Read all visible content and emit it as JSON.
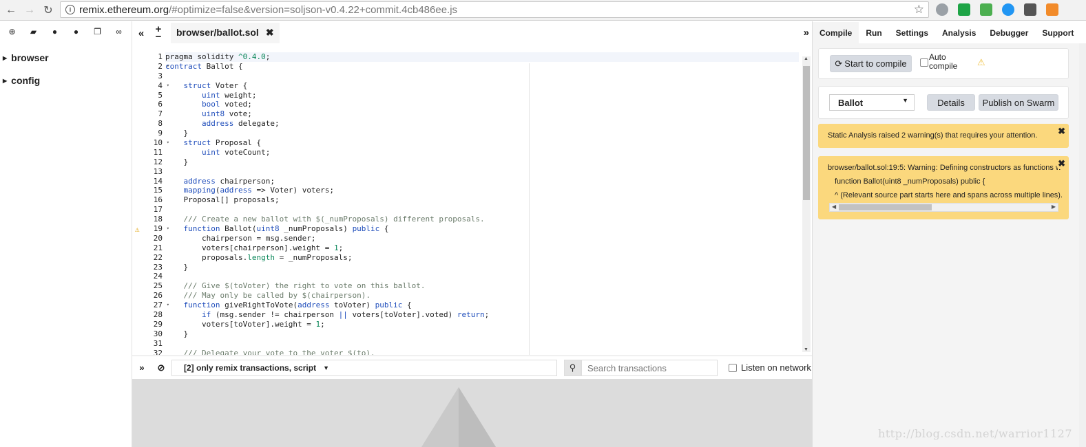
{
  "browser": {
    "url_host": "remix.ethereum.org",
    "url_path": "/#optimize=false&version=soljson-v0.4.22+commit.4cb486ee.js"
  },
  "file_explorer": {
    "items": [
      {
        "label": "browser"
      },
      {
        "label": "config"
      }
    ]
  },
  "editor": {
    "tab_label": "browser/ballot.sol",
    "gutter": [
      {
        "n": "1",
        "fold": "",
        "warn": ""
      },
      {
        "n": "2",
        "fold": "▾",
        "warn": ""
      },
      {
        "n": "3",
        "fold": "",
        "warn": ""
      },
      {
        "n": "4",
        "fold": "▾",
        "warn": ""
      },
      {
        "n": "5",
        "fold": "",
        "warn": ""
      },
      {
        "n": "6",
        "fold": "",
        "warn": ""
      },
      {
        "n": "7",
        "fold": "",
        "warn": ""
      },
      {
        "n": "8",
        "fold": "",
        "warn": ""
      },
      {
        "n": "9",
        "fold": "",
        "warn": ""
      },
      {
        "n": "10",
        "fold": "▾",
        "warn": ""
      },
      {
        "n": "11",
        "fold": "",
        "warn": ""
      },
      {
        "n": "12",
        "fold": "",
        "warn": ""
      },
      {
        "n": "13",
        "fold": "",
        "warn": ""
      },
      {
        "n": "14",
        "fold": "",
        "warn": ""
      },
      {
        "n": "15",
        "fold": "",
        "warn": ""
      },
      {
        "n": "16",
        "fold": "",
        "warn": ""
      },
      {
        "n": "17",
        "fold": "",
        "warn": ""
      },
      {
        "n": "18",
        "fold": "",
        "warn": ""
      },
      {
        "n": "19",
        "fold": "▾",
        "warn": "⚠"
      },
      {
        "n": "20",
        "fold": "",
        "warn": ""
      },
      {
        "n": "21",
        "fold": "",
        "warn": ""
      },
      {
        "n": "22",
        "fold": "",
        "warn": ""
      },
      {
        "n": "23",
        "fold": "",
        "warn": ""
      },
      {
        "n": "24",
        "fold": "",
        "warn": ""
      },
      {
        "n": "25",
        "fold": "",
        "warn": ""
      },
      {
        "n": "26",
        "fold": "",
        "warn": ""
      },
      {
        "n": "27",
        "fold": "▾",
        "warn": ""
      },
      {
        "n": "28",
        "fold": "",
        "warn": ""
      },
      {
        "n": "29",
        "fold": "",
        "warn": ""
      },
      {
        "n": "30",
        "fold": "",
        "warn": ""
      },
      {
        "n": "31",
        "fold": "",
        "warn": ""
      },
      {
        "n": "32",
        "fold": "",
        "warn": ""
      }
    ],
    "lines": [
      [
        [
          "t",
          "pragma solidity "
        ],
        [
          "num",
          "^0.4.0"
        ],
        [
          "t",
          ";"
        ]
      ],
      [
        [
          "kw",
          "contract"
        ],
        [
          "t",
          " Ballot {"
        ]
      ],
      [],
      [
        [
          "t",
          "    "
        ],
        [
          "kw",
          "struct"
        ],
        [
          "t",
          " Voter {"
        ]
      ],
      [
        [
          "t",
          "        "
        ],
        [
          "ty",
          "uint"
        ],
        [
          "t",
          " weight;"
        ]
      ],
      [
        [
          "t",
          "        "
        ],
        [
          "ty",
          "bool"
        ],
        [
          "t",
          " voted;"
        ]
      ],
      [
        [
          "t",
          "        "
        ],
        [
          "ty",
          "uint8"
        ],
        [
          "t",
          " vote;"
        ]
      ],
      [
        [
          "t",
          "        "
        ],
        [
          "ty",
          "address"
        ],
        [
          "t",
          " delegate;"
        ]
      ],
      [
        [
          "t",
          "    }"
        ]
      ],
      [
        [
          "t",
          "    "
        ],
        [
          "kw",
          "struct"
        ],
        [
          "t",
          " Proposal {"
        ]
      ],
      [
        [
          "t",
          "        "
        ],
        [
          "ty",
          "uint"
        ],
        [
          "t",
          " voteCount;"
        ]
      ],
      [
        [
          "t",
          "    }"
        ]
      ],
      [],
      [
        [
          "t",
          "    "
        ],
        [
          "ty",
          "address"
        ],
        [
          "t",
          " chairperson;"
        ]
      ],
      [
        [
          "t",
          "    "
        ],
        [
          "kw",
          "mapping"
        ],
        [
          "t",
          "("
        ],
        [
          "ty",
          "address"
        ],
        [
          "t",
          " => Voter) voters;"
        ]
      ],
      [
        [
          "t",
          "    Proposal[] proposals;"
        ]
      ],
      [],
      [
        [
          "t",
          "    "
        ],
        [
          "cm",
          "/// Create a new ballot with $(_numProposals) different proposals."
        ]
      ],
      [
        [
          "t",
          "    "
        ],
        [
          "kw",
          "function"
        ],
        [
          "t",
          " Ballot("
        ],
        [
          "ty",
          "uint8"
        ],
        [
          "t",
          " _numProposals) "
        ],
        [
          "kw",
          "public"
        ],
        [
          "t",
          " {"
        ]
      ],
      [
        [
          "t",
          "        chairperson = msg.sender;"
        ]
      ],
      [
        [
          "t",
          "        voters[chairperson].weight = "
        ],
        [
          "num",
          "1"
        ],
        [
          "t",
          ";"
        ]
      ],
      [
        [
          "t",
          "        proposals."
        ],
        [
          "num",
          "length"
        ],
        [
          "t",
          " = _numProposals;"
        ]
      ],
      [
        [
          "t",
          "    }"
        ]
      ],
      [],
      [
        [
          "t",
          "    "
        ],
        [
          "cm",
          "/// Give $(toVoter) the right to vote on this ballot."
        ]
      ],
      [
        [
          "t",
          "    "
        ],
        [
          "cm",
          "/// May only be called by $(chairperson)."
        ]
      ],
      [
        [
          "t",
          "    "
        ],
        [
          "kw",
          "function"
        ],
        [
          "t",
          " giveRightToVote("
        ],
        [
          "ty",
          "address"
        ],
        [
          "t",
          " toVoter) "
        ],
        [
          "kw",
          "public"
        ],
        [
          "t",
          " {"
        ]
      ],
      [
        [
          "t",
          "        "
        ],
        [
          "kw",
          "if"
        ],
        [
          "t",
          " (msg.sender != chairperson "
        ],
        [
          "kw",
          "||"
        ],
        [
          "t",
          " voters[toVoter].voted) "
        ],
        [
          "kw",
          "return"
        ],
        [
          "t",
          ";"
        ]
      ],
      [
        [
          "t",
          "        voters[toVoter].weight = "
        ],
        [
          "num",
          "1"
        ],
        [
          "t",
          ";"
        ]
      ],
      [
        [
          "t",
          "    }"
        ]
      ],
      [],
      [
        [
          "t",
          "    "
        ],
        [
          "cm",
          "/// Delegate your vote to the voter $(to)."
        ]
      ]
    ]
  },
  "terminal": {
    "filter_label": "[2] only remix transactions, script",
    "search_placeholder": "Search transactions",
    "listen_label": "Listen on network"
  },
  "right_panel": {
    "tabs": [
      "Compile",
      "Run",
      "Settings",
      "Analysis",
      "Debugger",
      "Support"
    ],
    "start_compile_label": "Start to compile",
    "auto_compile_label": "Auto compile",
    "contract_select": "Ballot",
    "details_label": "Details",
    "publish_label": "Publish on Swarm",
    "alert_static": "Static Analysis raised 2 warning(s) that requires your attention.",
    "warning_line1": "browser/ballot.sol:19:5: Warning: Defining constructors as functions w",
    "warning_line2": "function Ballot(uint8 _numProposals) public {",
    "warning_line3": "^ (Relevant source part starts here and spans across multiple lines)."
  },
  "watermark": "http://blog.csdn.net/warrior1127"
}
